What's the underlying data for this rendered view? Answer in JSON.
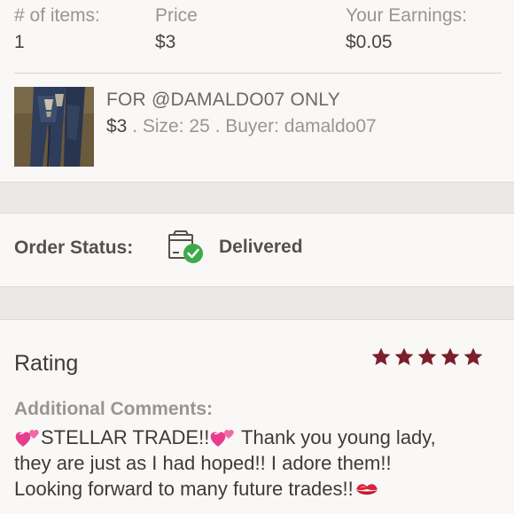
{
  "summary": {
    "items_label": "# of items:",
    "items_value": "1",
    "price_label": "Price",
    "price_value": "$3",
    "earnings_label": "Your Earnings:",
    "earnings_value": "$0.05"
  },
  "listing": {
    "title": "FOR @DAMALDO07 ONLY",
    "price": "$3",
    "meta": " . Size: 25 . Buyer: damaldo07",
    "thumbnail_icon": "jeans-photo"
  },
  "order": {
    "status_label": "Order Status:",
    "status_value": "Delivered",
    "status_icon": "package-delivered-icon"
  },
  "rating": {
    "label": "Rating",
    "stars": 5,
    "max_stars": 5,
    "star_color": "#7a1f2b",
    "comments_label": "Additional Comments:",
    "comment_line1_a": "STELLAR TRADE!!",
    "comment_line1_b": " Thank you young lady,",
    "comment_line2": "they are just as I had hoped!! I adore them!!",
    "comment_line3": "Looking forward to many future trades!!",
    "emoji_icons": [
      "two-hearts-icon",
      "two-hearts-icon",
      "kiss-mark-icon"
    ]
  }
}
